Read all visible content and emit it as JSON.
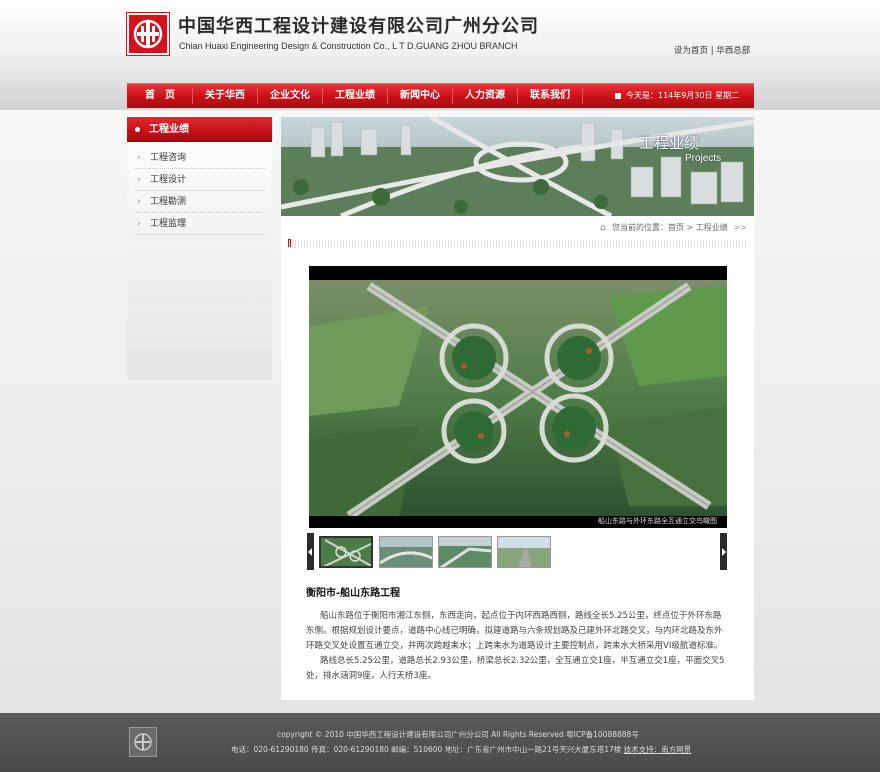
{
  "header": {
    "company_cn": "中国华西工程设计建设有限公司广州分公司",
    "company_en": "Chian Huaxi Engineering Design & Construction Co., L T D.GUANG ZHOU BRANCH",
    "link_home": "设为首页",
    "link_sep": "|",
    "link_hq": "华西总部"
  },
  "nav": {
    "items": [
      {
        "label": "首　页"
      },
      {
        "label": "关于华西"
      },
      {
        "label": "企业文化"
      },
      {
        "label": "工程业绩"
      },
      {
        "label": "新闻中心"
      },
      {
        "label": "人力资源"
      },
      {
        "label": "联系我们"
      }
    ],
    "date": "今天是：114年9月30日  星期二"
  },
  "sidebar": {
    "title": "工程业绩",
    "items": [
      {
        "label": "工程咨询"
      },
      {
        "label": "工程设计"
      },
      {
        "label": "工程勘测"
      },
      {
        "label": "工程监理"
      }
    ]
  },
  "banner": {
    "title": "工程业绩",
    "subtitle": "Projects"
  },
  "breadcrumb": {
    "text": "您当前的位置：首页 > 工程业绩",
    "arrows": ">>"
  },
  "photo": {
    "caption": "船山东路与外环东路全互通立交鸟瞰图"
  },
  "project": {
    "title": "衡阳市-船山东路工程",
    "paragraph1": "船山东路位于衡阳市湘江东侧，东西走向，起点位于内环西路西侧，路线全长5.25公里，终点位于外环东路东侧。根据规划设计要点，道路中心线已明确，拟建道路与六条规划路及已建外环北路交叉，与内环北路及东外环路交叉处设置互通立交，并两次跨越耒水；上跨耒水为道路设计主要控制点，跨耒水大桥采用VI级航道标准。",
    "paragraph2": "路线总长5.25公里，道路总长2.93公里，桥梁总长2.32公里，全互通立交1座，半互通立交1座，平面交叉5处，排水涵洞9座，人行天桥3座。"
  },
  "footer": {
    "copyright": "copyright © 2010 中国华西工程设计建设有限公司广州分公司 All Rights Reserved 粤ICP备10088888号",
    "contact": "电话：020-61290180  传真：020-61290180  邮编：510600  地址：广东省广州市中山一路21号天兴大厦东塔17楼",
    "tech": "技术支持：南方网景"
  },
  "colors": {
    "brand_red": "#d7101a",
    "footer_bg": "#4f4f4f"
  }
}
